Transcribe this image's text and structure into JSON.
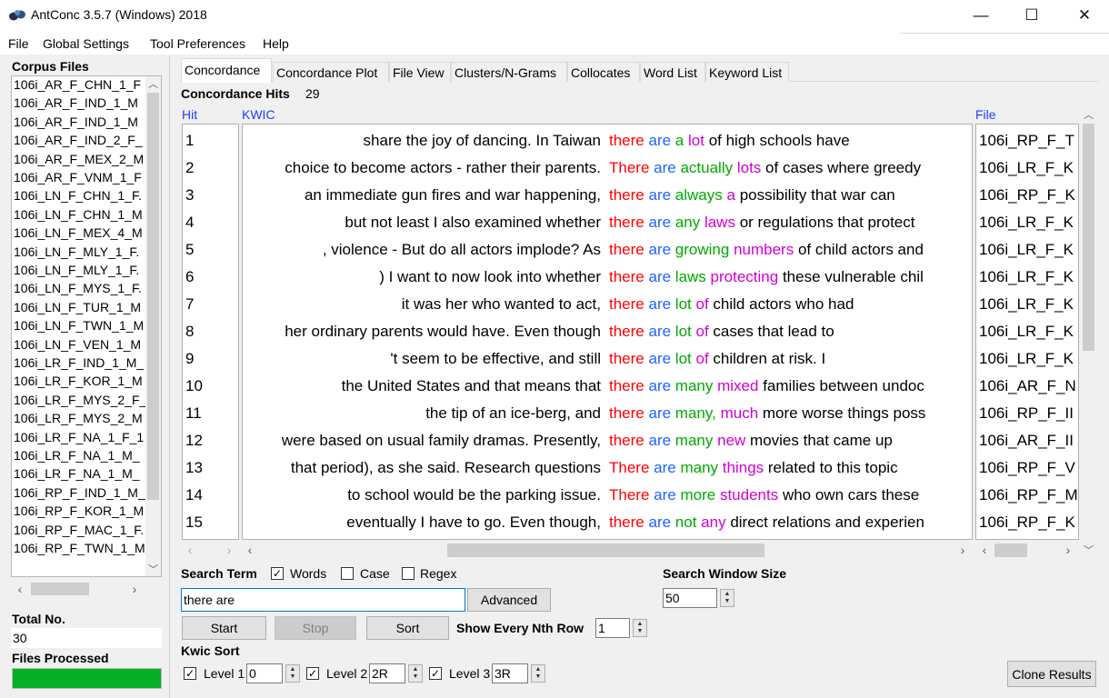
{
  "window": {
    "title": "AntConc 3.5.7 (Windows) 2018",
    "minimize": "—",
    "maximize": "☐",
    "close": "✕"
  },
  "menu": [
    "File",
    "Global Settings",
    "Tool Preferences",
    "Help"
  ],
  "sidebar": {
    "corpus_files_label": "Corpus Files",
    "files": [
      "106i_AR_F_CHN_1_F",
      "106i_AR_F_IND_1_M",
      "106i_AR_F_IND_1_M",
      "106i_AR_F_IND_2_F_",
      "106i_AR_F_MEX_2_M",
      "106i_AR_F_VNM_1_F",
      "106i_LN_F_CHN_1_F.",
      "106i_LN_F_CHN_1_M",
      "106i_LN_F_MEX_4_M",
      "106i_LN_F_MLY_1_F.",
      "106i_LN_F_MLY_1_F.",
      "106i_LN_F_MYS_1_F.",
      "106i_LN_F_TUR_1_M",
      "106i_LN_F_TWN_1_M",
      "106i_LN_F_VEN_1_M",
      "106i_LR_F_IND_1_M_",
      "106i_LR_F_KOR_1_M",
      "106i_LR_F_MYS_2_F_",
      "106i_LR_F_MYS_2_M",
      "106i_LR_F_NA_1_F_1",
      "106i_LR_F_NA_1_M_",
      "106i_LR_F_NA_1_M_",
      "106i_RP_F_IND_1_M_",
      "106i_RP_F_KOR_1_M",
      "106i_RP_F_MAC_1_F.",
      "106i_RP_F_TWN_1_M"
    ],
    "total_no_label": "Total No.",
    "total_no_value": "30",
    "files_processed_label": "Files Processed",
    "progress_fraction": 1.0
  },
  "tabs": [
    "Concordance",
    "Concordance Plot",
    "File View",
    "Clusters/N-Grams",
    "Collocates",
    "Word List",
    "Keyword List"
  ],
  "concordance": {
    "hits_label": "Concordance Hits",
    "hits_count": "29",
    "col_hit": "Hit",
    "col_kwic": "KWIC",
    "col_file": "File",
    "rows": [
      {
        "n": "1",
        "left": "share the joy of dancing. In Taiwan",
        "kw": "there",
        "w1": "are",
        "w2": "a",
        "w3": "lot",
        "sep": " ",
        "rest": "of high schools have",
        "file": "106i_RP_F_T"
      },
      {
        "n": "2",
        "left": "choice to become actors - rather their parents.",
        "kw": "There",
        "w1": "are",
        "w2": "actually",
        "w3": "lots",
        "sep": " ",
        "rest": "of cases where greedy",
        "file": "106i_LR_F_K"
      },
      {
        "n": "3",
        "left": "an immediate gun fires and war happening,",
        "kw": "there",
        "w1": "are",
        "w2": "always",
        "w3": "a",
        "sep": " ",
        "rest": "possibility that war can",
        "file": "106i_RP_F_K"
      },
      {
        "n": "4",
        "left": "but not least I also examined whether",
        "kw": "there",
        "w1": "are",
        "w2": "any",
        "w3": "laws",
        "sep": " ",
        "rest": "or regulations that protect",
        "file": "106i_LR_F_K"
      },
      {
        "n": "5",
        "left": ", violence - But do all actors implode?  As",
        "kw": "there",
        "w1": "are",
        "w2": "growing",
        "w3": "numbers",
        "sep": " ",
        "rest": "of child actors and",
        "file": "106i_LR_F_K"
      },
      {
        "n": "6",
        "left": ") I want to now look into whether",
        "kw": "there",
        "w1": "are",
        "w2": "laws",
        "w3": "protecting",
        "sep": " ",
        "rest": "these vulnerable chil",
        "file": "106i_LR_F_K"
      },
      {
        "n": "7",
        "left": "it was her who wanted to act,",
        "kw": "there",
        "w1": "are",
        "w2": "lot",
        "w3": "of",
        "sep": " ",
        "rest": "child actors who had",
        "file": "106i_LR_F_K"
      },
      {
        "n": "8",
        "left": "her ordinary parents would have. Even though",
        "kw": "there",
        "w1": "are",
        "w2": "lot",
        "w3": "of",
        "sep": " ",
        "rest": "cases that lead to",
        "file": "106i_LR_F_K"
      },
      {
        "n": "9",
        "left": "'t seem to be effective, and still",
        "kw": "there",
        "w1": "are",
        "w2": "lot",
        "w3": "of",
        "sep": " ",
        "rest": "children at risk. I",
        "file": "106i_LR_F_K"
      },
      {
        "n": "10",
        "left": "the United States and that means that",
        "kw": "there",
        "w1": "are",
        "w2": "many",
        "w3": "mixed",
        "sep": " ",
        "rest": "families between undoc",
        "file": "106i_AR_F_N"
      },
      {
        "n": "11",
        "left": "the tip of an ice-berg, and",
        "kw": "there",
        "w1": "are",
        "w2": "many,",
        "w3": "much",
        "sep": " ",
        "rest": "more worse things poss",
        "file": "106i_RP_F_II"
      },
      {
        "n": "12",
        "left": "were based on usual family dramas. Presently,",
        "kw": "there",
        "w1": "are",
        "w2": "many",
        "w3": "new",
        "sep": " ",
        "rest": "movies that came up",
        "file": "106i_AR_F_II"
      },
      {
        "n": "13",
        "left": "that period), as she said.  Research questions",
        "kw": "There",
        "w1": "are",
        "w2": "many",
        "w3": "things",
        "sep": " ",
        "rest": "related to this topic",
        "file": "106i_RP_F_V"
      },
      {
        "n": "14",
        "left": "to school would be the parking issue.",
        "kw": "There",
        "w1": "are",
        "w2": "more",
        "w3": "students",
        "sep": " ",
        "rest": "who own cars these",
        "file": "106i_RP_F_M"
      },
      {
        "n": "15",
        "left": "eventually I have to go. Even though,",
        "kw": "there",
        "w1": "are",
        "w2": "not",
        "w3": "any",
        "sep": " ",
        "rest": "direct relations and experien",
        "file": "106i_RP_F_K"
      }
    ]
  },
  "search": {
    "label": "Search Term",
    "words_label": "Words",
    "words_checked": true,
    "case_label": "Case",
    "case_checked": false,
    "regex_label": "Regex",
    "regex_checked": false,
    "term_value": "there are",
    "advanced_label": "Advanced",
    "window_size_label": "Search Window Size",
    "window_size_value": "50",
    "start_label": "Start",
    "stop_label": "Stop",
    "sort_label": "Sort",
    "nth_row_label": "Show Every Nth Row",
    "nth_row_value": "1"
  },
  "kwic_sort": {
    "label": "Kwic Sort",
    "levels": [
      {
        "label": "Level 1",
        "value": "0",
        "checked": true
      },
      {
        "label": "Level 2",
        "value": "2R",
        "checked": true
      },
      {
        "label": "Level 3",
        "value": "3R",
        "checked": true
      }
    ]
  },
  "clone_results_label": "Clone Results",
  "colors": {
    "keyword": "#ff0000",
    "context1": "#1e62ff",
    "context2": "#00aa00",
    "context3": "#d100d1",
    "progress": "#06b025",
    "header_blue": "#1a3fff"
  },
  "icons": {
    "app": "antconc-icon",
    "check": "✓"
  }
}
